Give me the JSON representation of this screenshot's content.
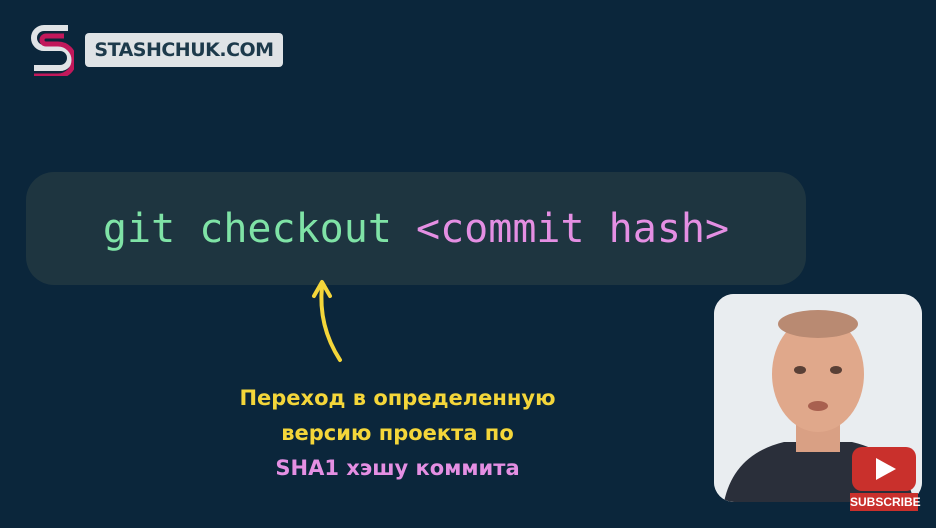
{
  "brand": {
    "name": "STASHCHUK.COM",
    "logo_letter": "S"
  },
  "command": {
    "keyword": "git checkout",
    "argument": "<commit hash>"
  },
  "caption": {
    "line1": "Переход в определенную",
    "line2": "версию проекта по",
    "line3": "SHA1 хэшу коммита"
  },
  "subscribe": {
    "label": "SUBSCRIBE"
  },
  "colors": {
    "background": "#0b263b",
    "command_keyword": "#7fe3a6",
    "command_argument": "#e48fe3",
    "caption_yellow": "#f4d63a",
    "caption_pink": "#e48fe3",
    "subscribe_red": "#c9302c"
  }
}
